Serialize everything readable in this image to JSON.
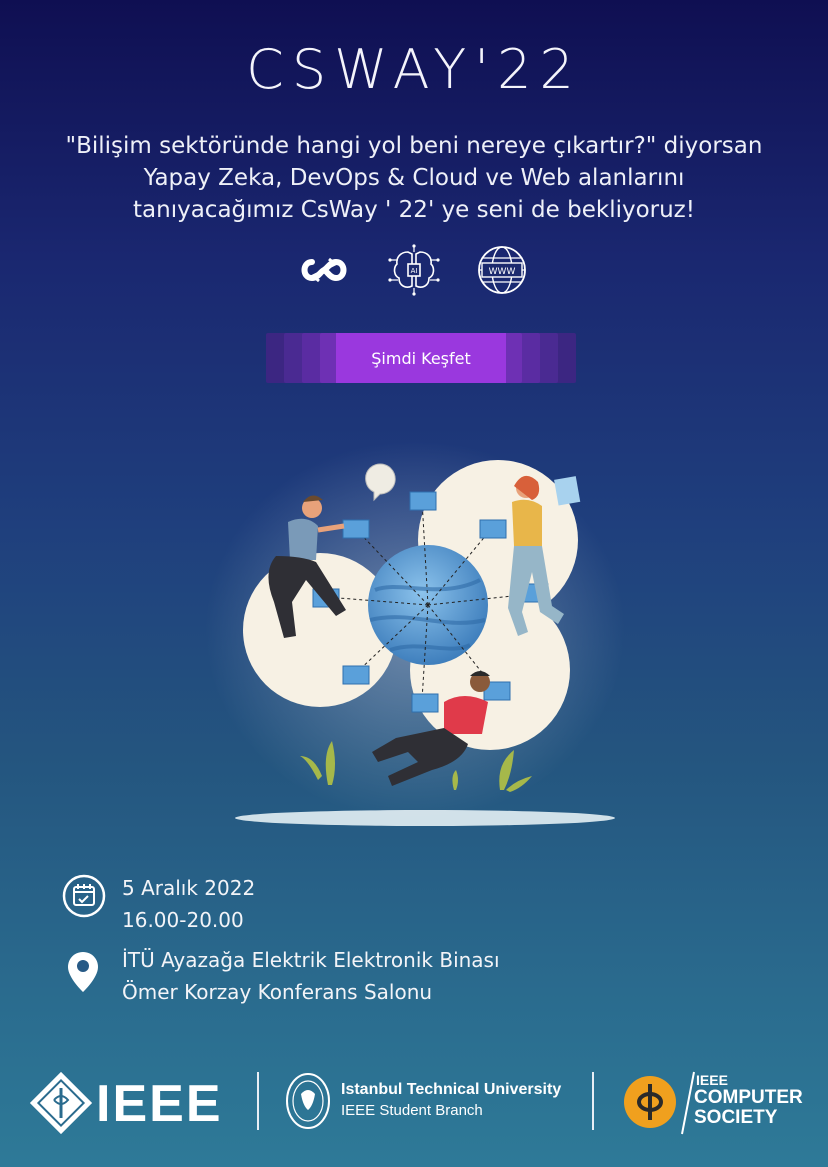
{
  "title": "CSWAY'22",
  "intro": {
    "line1": "\"Bilişim sektöründe hangi yol beni nereye çıkartır?\" diyorsan",
    "line2": "Yapay  Zeka,  DevOps & Cloud ve Web alanlarını",
    "line3": "tanıyacağımız CsWay ' 22' ye seni de bekliyoruz!"
  },
  "topic_icons": [
    "devops-loop-icon",
    "ai-chip-icon",
    "www-globe-icon"
  ],
  "ai_chip_label": "AI",
  "www_label": "WWW",
  "cta_label": "Şimdi Keşfet",
  "event": {
    "date": "5 Aralık 2022",
    "time": "16.00-20.00",
    "venue_line1": "İTÜ Ayazağa Elektrik Elektronik Binası",
    "venue_line2": "Ömer Korzay Konferans Salonu"
  },
  "footer": {
    "ieee": "IEEE",
    "itu_name": "Istanbul Technical University",
    "itu_branch": "IEEE Student Branch",
    "cs_line1": "IEEE",
    "cs_line2": "COMPUTER",
    "cs_line3": "SOCIETY"
  },
  "colors": {
    "accent_purple": "#9a38de",
    "cs_orange": "#f0a01e",
    "globe_blue": "#5e9ed4"
  }
}
